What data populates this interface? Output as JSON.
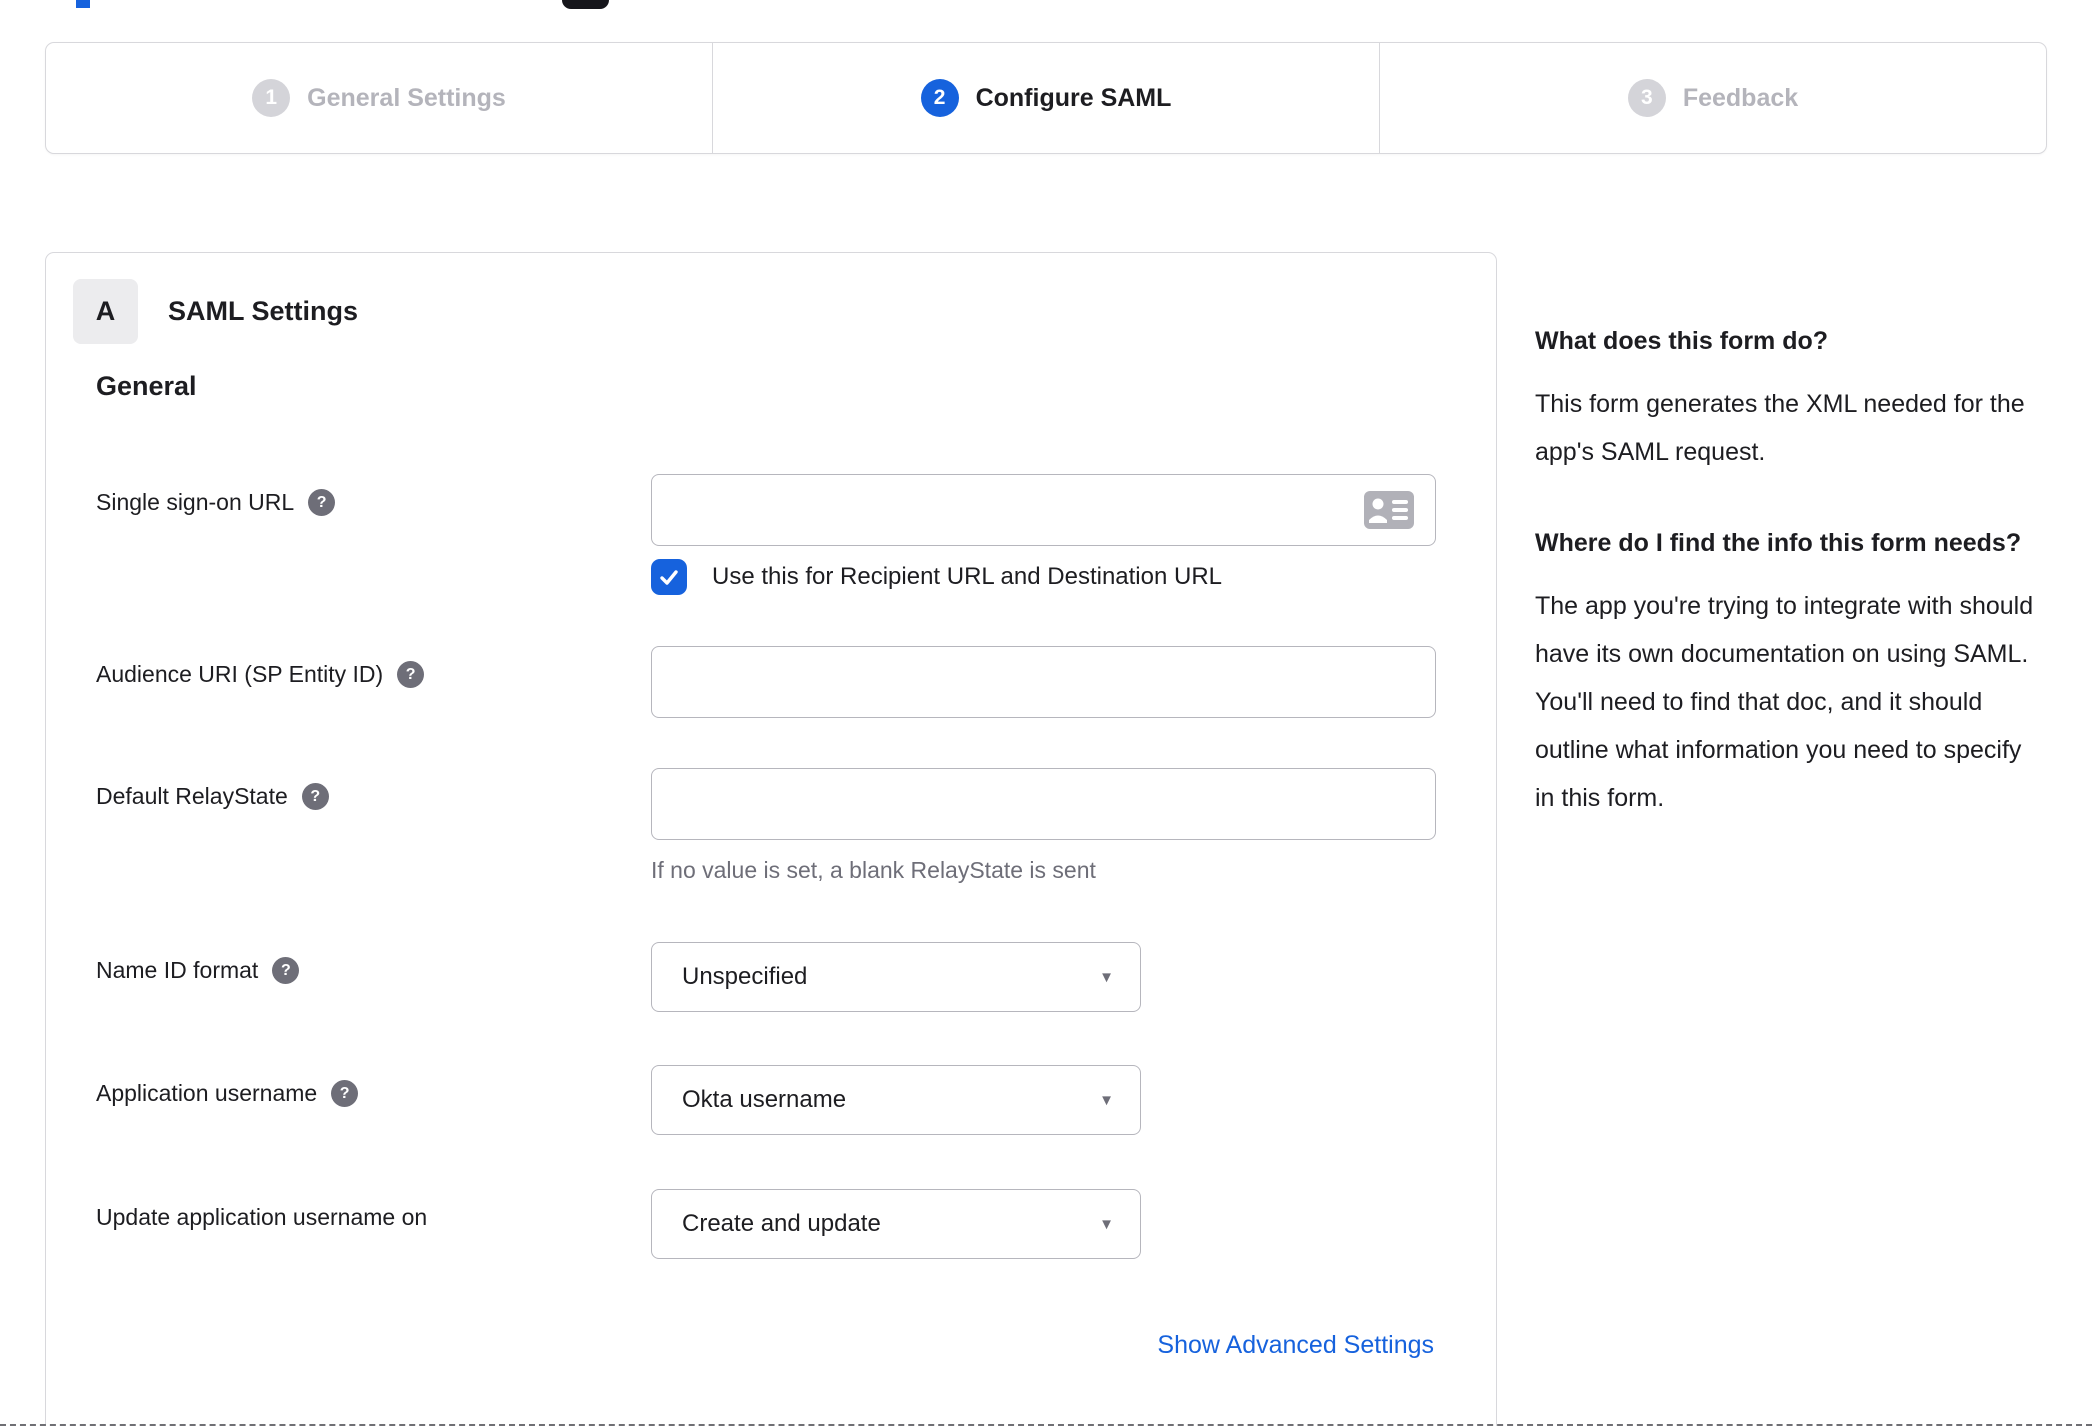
{
  "colors": {
    "accent_blue": "#1662dd",
    "inactive_gray": "#b4b4bb",
    "border_gray": "#d8d8dc",
    "help_icon_gray": "#6e6e78"
  },
  "icons": {
    "help_glyph": "?",
    "caret_glyph": "▼"
  },
  "stepper": {
    "steps": [
      {
        "number": "1",
        "label": "General Settings",
        "state": "inactive"
      },
      {
        "number": "2",
        "label": "Configure SAML",
        "state": "active"
      },
      {
        "number": "3",
        "label": "Feedback",
        "state": "inactive"
      }
    ]
  },
  "panel": {
    "section_badge": "A",
    "section_title": "SAML Settings",
    "group_title": "General",
    "fields": [
      {
        "label": "Single sign-on URL",
        "type": "text",
        "value": "",
        "checkbox_label": "Use this for Recipient URL and Destination URL",
        "checked": true
      },
      {
        "label": "Audience URI (SP Entity ID)",
        "type": "text",
        "value": ""
      },
      {
        "label": "Default RelayState",
        "type": "text",
        "value": "",
        "helper": "If no value is set, a blank RelayState is sent"
      },
      {
        "label": "Name ID format",
        "type": "select",
        "value": "Unspecified"
      },
      {
        "label": "Application username",
        "type": "select",
        "value": "Okta username"
      },
      {
        "label": "Update application username on",
        "type": "select",
        "value": "Create and update"
      }
    ],
    "advanced_link": "Show Advanced Settings"
  },
  "help_panel": {
    "q1": "What does this form do?",
    "a1": "This form generates the XML needed for the app's SAML request.",
    "q2": "Where do I find the info this form needs?",
    "a2": "The app you're trying to integrate with should have its own documentation on using SAML. You'll need to find that doc, and it should outline what information you need to specify in this form."
  }
}
